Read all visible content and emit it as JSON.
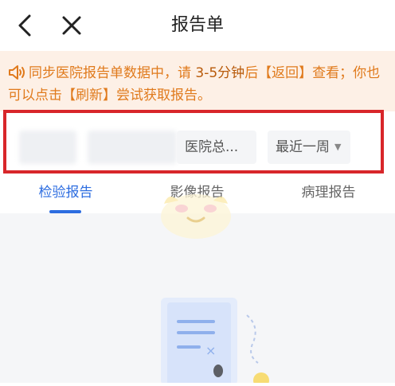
{
  "header": {
    "title": "报告单",
    "back_icon": "chevron-left-icon",
    "close_icon": "close-icon"
  },
  "notice": {
    "icon": "speaker-icon",
    "part1": "同步医院报告单数据中，请 ",
    "duration": "3-5分钟",
    "part2": "后【返回】查看；你也可以点击【刷新】尝试获取报告。"
  },
  "filters": {
    "hospital_label": "医院总...",
    "period_label": "最近一周"
  },
  "tabs": [
    {
      "label": "检验报告",
      "active": true
    },
    {
      "label": "影像报告",
      "active": false
    },
    {
      "label": "病理报告",
      "active": false
    }
  ],
  "colors": {
    "accent": "#2d6de0",
    "notice_text": "#e07a1c",
    "notice_bg": "#fdf0e6",
    "highlight_border": "#d8262a"
  }
}
